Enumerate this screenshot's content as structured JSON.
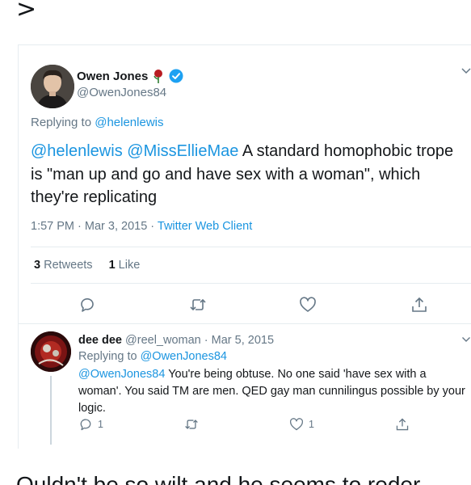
{
  "top": {
    "chevron": ">"
  },
  "tweet": {
    "author_name": "Owen Jones",
    "author_handle": "@OwenJones84",
    "replying_prefix": "Replying to",
    "replying_handle": "@helenlewis",
    "text_mention_1": "@helenlewis",
    "text_mention_2": "@MissEllieMae",
    "text_body": " A standard homophobic trope is \"man up and go and have sex with a woman\", which they're replicating",
    "time": "1:57 PM · Mar 3, 2015",
    "separator": " · ",
    "client": "Twitter Web Client",
    "retweet_count": "3",
    "retweet_label": "Retweets",
    "like_count": "1",
    "like_label": "Like"
  },
  "reply": {
    "author_name": "dee dee",
    "author_handle": "@reel_woman",
    "date": " · Mar 5, 2015",
    "replying_prefix": "Replying to",
    "replying_handle": "@OwenJones84",
    "mention": "@OwenJones84",
    "text_body": " You're being obtuse. No one said 'have sex with a woman'. You said TM are men. QED gay man cunnilingus possible by your logic.",
    "reply_count": "1",
    "like_count": "1"
  },
  "bottom": {
    "text": "Ouldn't be so wilt and he seems to reder"
  },
  "colors": {
    "link": "#1b95e0",
    "muted": "#657786",
    "verified": "#1da1f2",
    "rose": "#b81c22"
  }
}
